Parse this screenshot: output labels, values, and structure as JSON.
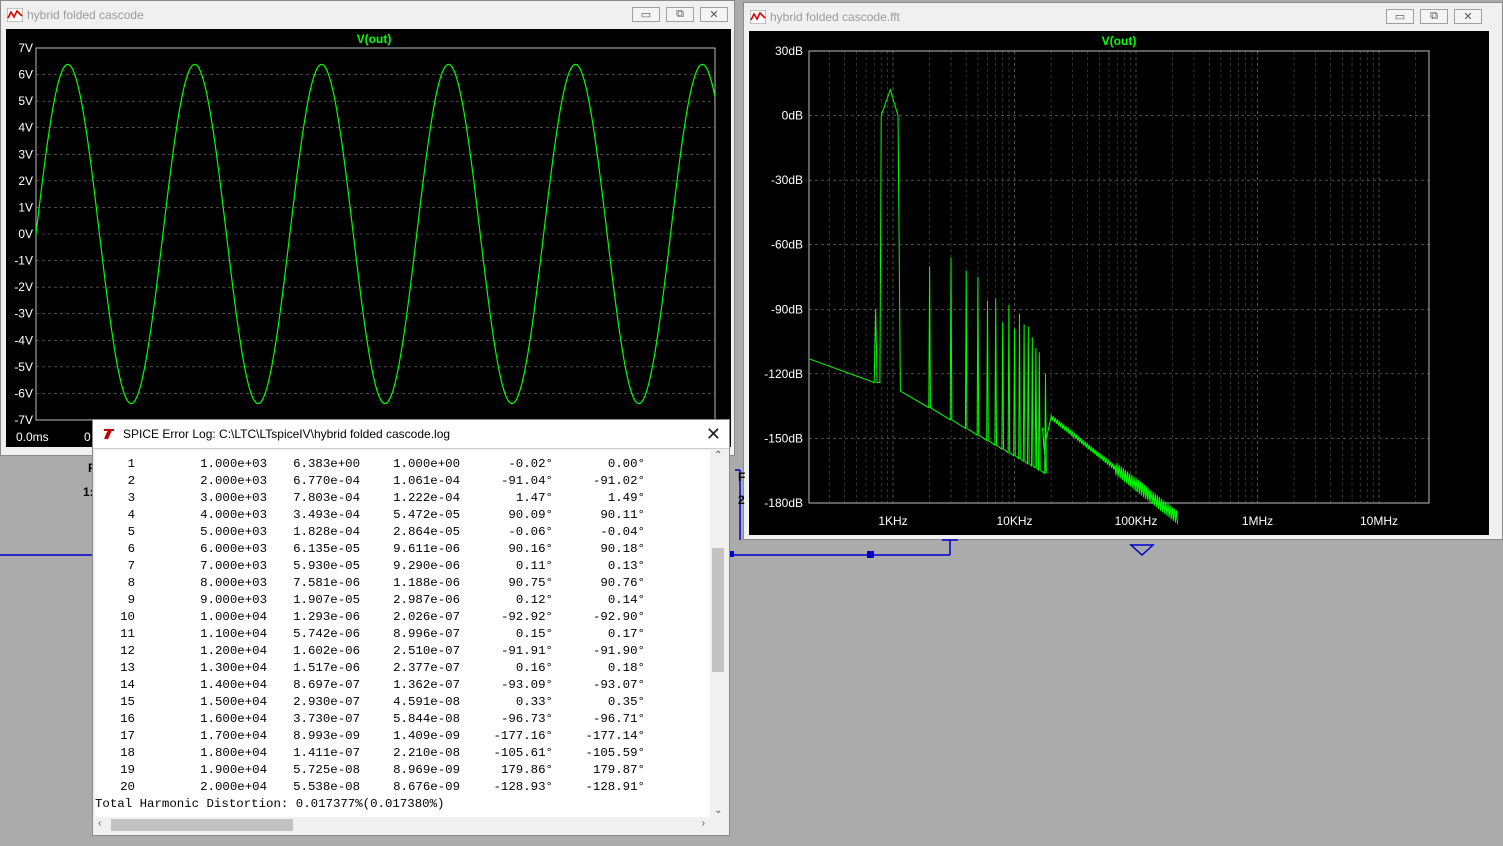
{
  "time_window": {
    "title": "hybrid folded cascode",
    "trace": "V(out)",
    "y_ticks": [
      "7V",
      "6V",
      "5V",
      "4V",
      "3V",
      "2V",
      "1V",
      "0V",
      "-1V",
      "-2V",
      "-3V",
      "-4V",
      "-5V",
      "-6V",
      "-7V"
    ],
    "x_ticks": [
      "0.0ms",
      "0"
    ],
    "trace_color": "#00ff00"
  },
  "fft_window": {
    "title": "hybrid folded cascode.fft",
    "trace": "V(out)",
    "y_ticks": [
      "30dB",
      "0dB",
      "-30dB",
      "-60dB",
      "-90dB",
      "-120dB",
      "-150dB",
      "-180dB"
    ],
    "x_ticks": [
      "1KHz",
      "10KHz",
      "100KHz",
      "1MHz",
      "10MHz"
    ],
    "trace_color": "#00ff00"
  },
  "window_buttons": {
    "minimize": "▭",
    "restore": "⧉",
    "close": "✕"
  },
  "log_window": {
    "title": "SPICE Error Log: C:\\LTC\\LTspiceIV\\hybrid folded cascode.log",
    "rows": [
      [
        "1",
        "1.000e+03",
        "6.383e+00",
        "1.000e+00",
        "-0.02°",
        "0.00°"
      ],
      [
        "2",
        "2.000e+03",
        "6.770e-04",
        "1.061e-04",
        "-91.04°",
        "-91.02°"
      ],
      [
        "3",
        "3.000e+03",
        "7.803e-04",
        "1.222e-04",
        "1.47°",
        "1.49°"
      ],
      [
        "4",
        "4.000e+03",
        "3.493e-04",
        "5.472e-05",
        "90.09°",
        "90.11°"
      ],
      [
        "5",
        "5.000e+03",
        "1.828e-04",
        "2.864e-05",
        "-0.06°",
        "-0.04°"
      ],
      [
        "6",
        "6.000e+03",
        "6.135e-05",
        "9.611e-06",
        "90.16°",
        "90.18°"
      ],
      [
        "7",
        "7.000e+03",
        "5.930e-05",
        "9.290e-06",
        "0.11°",
        "0.13°"
      ],
      [
        "8",
        "8.000e+03",
        "7.581e-06",
        "1.188e-06",
        "90.75°",
        "90.76°"
      ],
      [
        "9",
        "9.000e+03",
        "1.907e-05",
        "2.987e-06",
        "0.12°",
        "0.14°"
      ],
      [
        "10",
        "1.000e+04",
        "1.293e-06",
        "2.026e-07",
        "-92.92°",
        "-92.90°"
      ],
      [
        "11",
        "1.100e+04",
        "5.742e-06",
        "8.996e-07",
        "0.15°",
        "0.17°"
      ],
      [
        "12",
        "1.200e+04",
        "1.602e-06",
        "2.510e-07",
        "-91.91°",
        "-91.90°"
      ],
      [
        "13",
        "1.300e+04",
        "1.517e-06",
        "2.377e-07",
        "0.16°",
        "0.18°"
      ],
      [
        "14",
        "1.400e+04",
        "8.697e-07",
        "1.362e-07",
        "-93.09°",
        "-93.07°"
      ],
      [
        "15",
        "1.500e+04",
        "2.930e-07",
        "4.591e-08",
        "0.33°",
        "0.35°"
      ],
      [
        "16",
        "1.600e+04",
        "3.730e-07",
        "5.844e-08",
        "-96.73°",
        "-96.71°"
      ],
      [
        "17",
        "1.700e+04",
        "8.993e-09",
        "1.409e-09",
        "-177.16°",
        "-177.14°"
      ],
      [
        "18",
        "1.800e+04",
        "1.411e-07",
        "2.210e-08",
        "-105.61°",
        "-105.59°"
      ],
      [
        "19",
        "1.900e+04",
        "5.725e-08",
        "8.969e-09",
        "179.86°",
        "179.87°"
      ],
      [
        "20",
        "2.000e+04",
        "5.538e-08",
        "8.676e-09",
        "-128.93°",
        "-128.91°"
      ]
    ],
    "thd": "Total Harmonic Distortion: 0.017377%(0.017380%)"
  },
  "schematic_fragments": {
    "left_top": "F",
    "left_bottom": "1:",
    "right_top": "F",
    "right_bottom": "2"
  }
}
